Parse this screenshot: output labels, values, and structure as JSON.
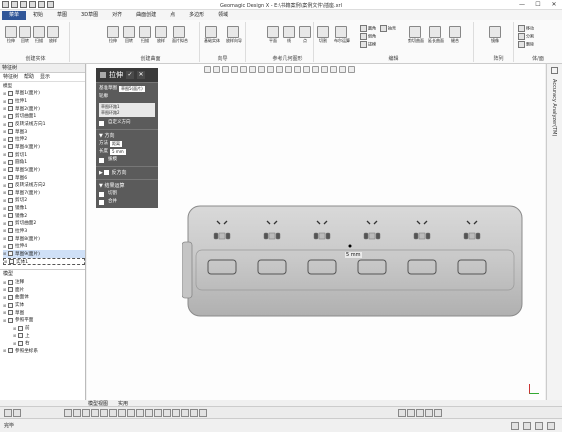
{
  "window": {
    "title": "Geomagic Design X - E:\\书籍案例\\案例文件\\插座.xrl",
    "minimize": "—",
    "maximize": "☐",
    "close": "✕"
  },
  "menu": {
    "tabs": [
      "菜单",
      "初始",
      "草图",
      "3D草图",
      "对齐",
      "曲面创建",
      "点",
      "多边形",
      "领域"
    ],
    "active_index": 0
  },
  "ribbon": {
    "groups": [
      {
        "label": "创建实体",
        "buttons": [
          "拉伸",
          "回转",
          "扫描",
          "放样",
          "基础实体"
        ]
      },
      {
        "label": "创建曲面",
        "buttons": [
          "拉伸",
          "回转",
          "扫描",
          "放样",
          "面片拟合"
        ]
      },
      {
        "label": "向导",
        "buttons": [
          "基础实体",
          "放样向导"
        ]
      },
      {
        "label": "参考几何图形",
        "buttons": [
          "平面",
          "线",
          "点"
        ]
      },
      {
        "label": "编辑",
        "buttons": [
          "切割",
          "布尔运算",
          "圆角",
          "倒角",
          "拔模",
          "抽壳",
          "剪切曲面",
          "延长曲面",
          "缝合"
        ]
      },
      {
        "label": "阵列",
        "buttons": [
          "镜像"
        ]
      },
      {
        "label": "体/面",
        "buttons": [
          "移动",
          "分割",
          "删除"
        ]
      }
    ]
  },
  "left_panel": {
    "tabs": [
      "特征树",
      "帮助",
      "显示"
    ],
    "tree_root": "模型",
    "feature_items": [
      "草图1(面片)",
      "拉伸1",
      "草图2(面片)",
      "剪切曲面1",
      "反转法线方向1",
      "草图3",
      "拉伸2",
      "草图4(面片)",
      "剪切1",
      "圆角1",
      "草图5(面片)",
      "草图6",
      "反转法线方向2",
      "草图7(面片)",
      "剪切2",
      "镜像1",
      "镜像2",
      "剪切曲面2",
      "拉伸3",
      "草图8(面片)",
      "拉伸4",
      "草图9(面片)",
      "实体1"
    ],
    "selected_index": 21,
    "model_label": "模型",
    "model_items": [
      "注释",
      "面片",
      "曲面体",
      "实体",
      "草图",
      "参照平面",
      "前",
      "上",
      "右",
      "参照坐标系"
    ]
  },
  "extrude_dialog": {
    "title": "拉伸",
    "ok": "✓",
    "cancel": "✕",
    "base_sketch_label": "基准草图",
    "base_sketch_value": "草图5(面片)",
    "outline_label": "轮廓",
    "outline_value_1": "草图环路1",
    "outline_value_2": "草图环路2",
    "custom_direction": "自定义方向",
    "direction_section": "方向",
    "method_label": "方法",
    "method_value": "距离",
    "length_label": "长度",
    "length_value": "5 mm",
    "draft_label": "拔模",
    "reverse_section": "反方向",
    "result_section": "结果运算",
    "cut_label": "切割",
    "merge_label": "合并"
  },
  "viewport": {
    "dimension_label": "5 mm",
    "panel_side_label": "Accuracy Analyzer(TM)"
  },
  "bottom": {
    "tabs": [
      "模型视图",
      "实用"
    ],
    "status": "完毕"
  }
}
